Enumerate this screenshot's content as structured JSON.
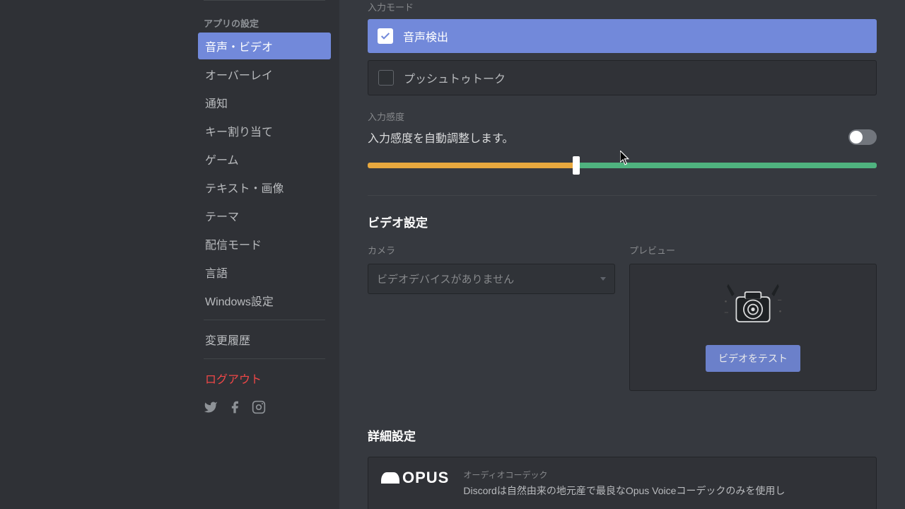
{
  "sidebar": {
    "header_app": "アプリの設定",
    "items": [
      {
        "label": "音声・ビデオ",
        "name": "voice-video",
        "active": true
      },
      {
        "label": "オーバーレイ",
        "name": "overlay"
      },
      {
        "label": "通知",
        "name": "notifications"
      },
      {
        "label": "キー割り当て",
        "name": "keybinds"
      },
      {
        "label": "ゲーム",
        "name": "game-activity"
      },
      {
        "label": "テキスト・画像",
        "name": "text-images"
      },
      {
        "label": "テーマ",
        "name": "appearance"
      },
      {
        "label": "配信モード",
        "name": "streamer-mode"
      },
      {
        "label": "言語",
        "name": "language"
      },
      {
        "label": "Windows設定",
        "name": "windows-settings"
      }
    ],
    "changelog": "変更履歴",
    "logout": "ログアウト"
  },
  "input_mode": {
    "header": "入力モード",
    "voice_activity": "音声検出",
    "ptt": "プッシュトゥトーク"
  },
  "sensitivity": {
    "label": "入力感度",
    "desc": "入力感度を自動調整します。",
    "slider_value_percent": 41,
    "auto": false
  },
  "video": {
    "header": "ビデオ設定",
    "camera_label": "カメラ",
    "camera_value": "ビデオデバイスがありません",
    "preview_label": "プレビュー",
    "test_btn": "ビデオをテスト"
  },
  "advanced": {
    "header": "詳細設定",
    "codec_label": "オーディオコーデック",
    "codec_desc": "Discordは自然由来の地元産で最良なOpus Voiceコーデックのみを使用し",
    "opus": "OPUS"
  }
}
